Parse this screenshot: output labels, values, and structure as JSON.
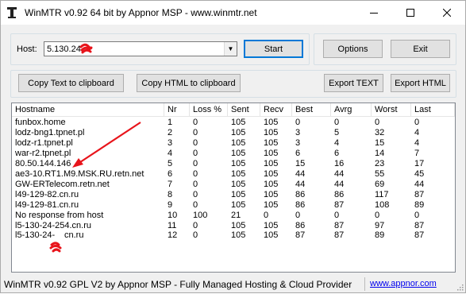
{
  "window": {
    "title": "WinMTR v0.92 64 bit by Appnor MSP - www.winmtr.net",
    "minimize_icon": "minimize-icon",
    "maximize_icon": "maximize-icon",
    "close_icon": "close-icon"
  },
  "host": {
    "label": "Host:",
    "value": "5.130.24.",
    "start_label": "Start"
  },
  "buttons": {
    "options": "Options",
    "exit": "Exit",
    "copy_text": "Copy Text to clipboard",
    "copy_html": "Copy HTML to clipboard",
    "export_text": "Export TEXT",
    "export_html": "Export HTML"
  },
  "table": {
    "columns": [
      "Hostname",
      "Nr",
      "Loss %",
      "Sent",
      "Recv",
      "Best",
      "Avrg",
      "Worst",
      "Last"
    ],
    "rows": [
      [
        "funbox.home",
        "1",
        "0",
        "105",
        "105",
        "0",
        "0",
        "0",
        "0"
      ],
      [
        "lodz-bng1.tpnet.pl",
        "2",
        "0",
        "105",
        "105",
        "3",
        "5",
        "32",
        "4"
      ],
      [
        "lodz-r1.tpnet.pl",
        "3",
        "0",
        "105",
        "105",
        "3",
        "4",
        "15",
        "4"
      ],
      [
        "war-r2.tpnet.pl",
        "4",
        "0",
        "105",
        "105",
        "6",
        "6",
        "14",
        "7"
      ],
      [
        "80.50.144.146",
        "5",
        "0",
        "105",
        "105",
        "15",
        "16",
        "23",
        "17"
      ],
      [
        "ae3-10.RT1.M9.MSK.RU.retn.net",
        "6",
        "0",
        "105",
        "105",
        "44",
        "44",
        "55",
        "45"
      ],
      [
        "GW-ERTelecom.retn.net",
        "7",
        "0",
        "105",
        "105",
        "44",
        "44",
        "69",
        "44"
      ],
      [
        "l49-129-82.cn.ru",
        "8",
        "0",
        "105",
        "105",
        "86",
        "86",
        "117",
        "87"
      ],
      [
        "l49-129-81.cn.ru",
        "9",
        "0",
        "105",
        "105",
        "86",
        "87",
        "108",
        "89"
      ],
      [
        "No response from host",
        "10",
        "100",
        "21",
        "0",
        "0",
        "0",
        "0",
        "0"
      ],
      [
        "l5-130-24-254.cn.ru",
        "11",
        "0",
        "105",
        "105",
        "86",
        "87",
        "97",
        "87"
      ],
      [
        "l5-130-24-",
        "12",
        "0",
        "105",
        "105",
        "87",
        "87",
        "89",
        "87"
      ]
    ],
    "last_row_suffix": "cn.ru"
  },
  "status": {
    "text": "WinMTR v0.92 GPL V2 by Appnor MSP - Fully Managed Hosting & Cloud Provider",
    "link": "www.appnor.com"
  },
  "colors": {
    "annotation": "#e8141b",
    "link": "#0000ee",
    "focus": "#0078d7"
  }
}
